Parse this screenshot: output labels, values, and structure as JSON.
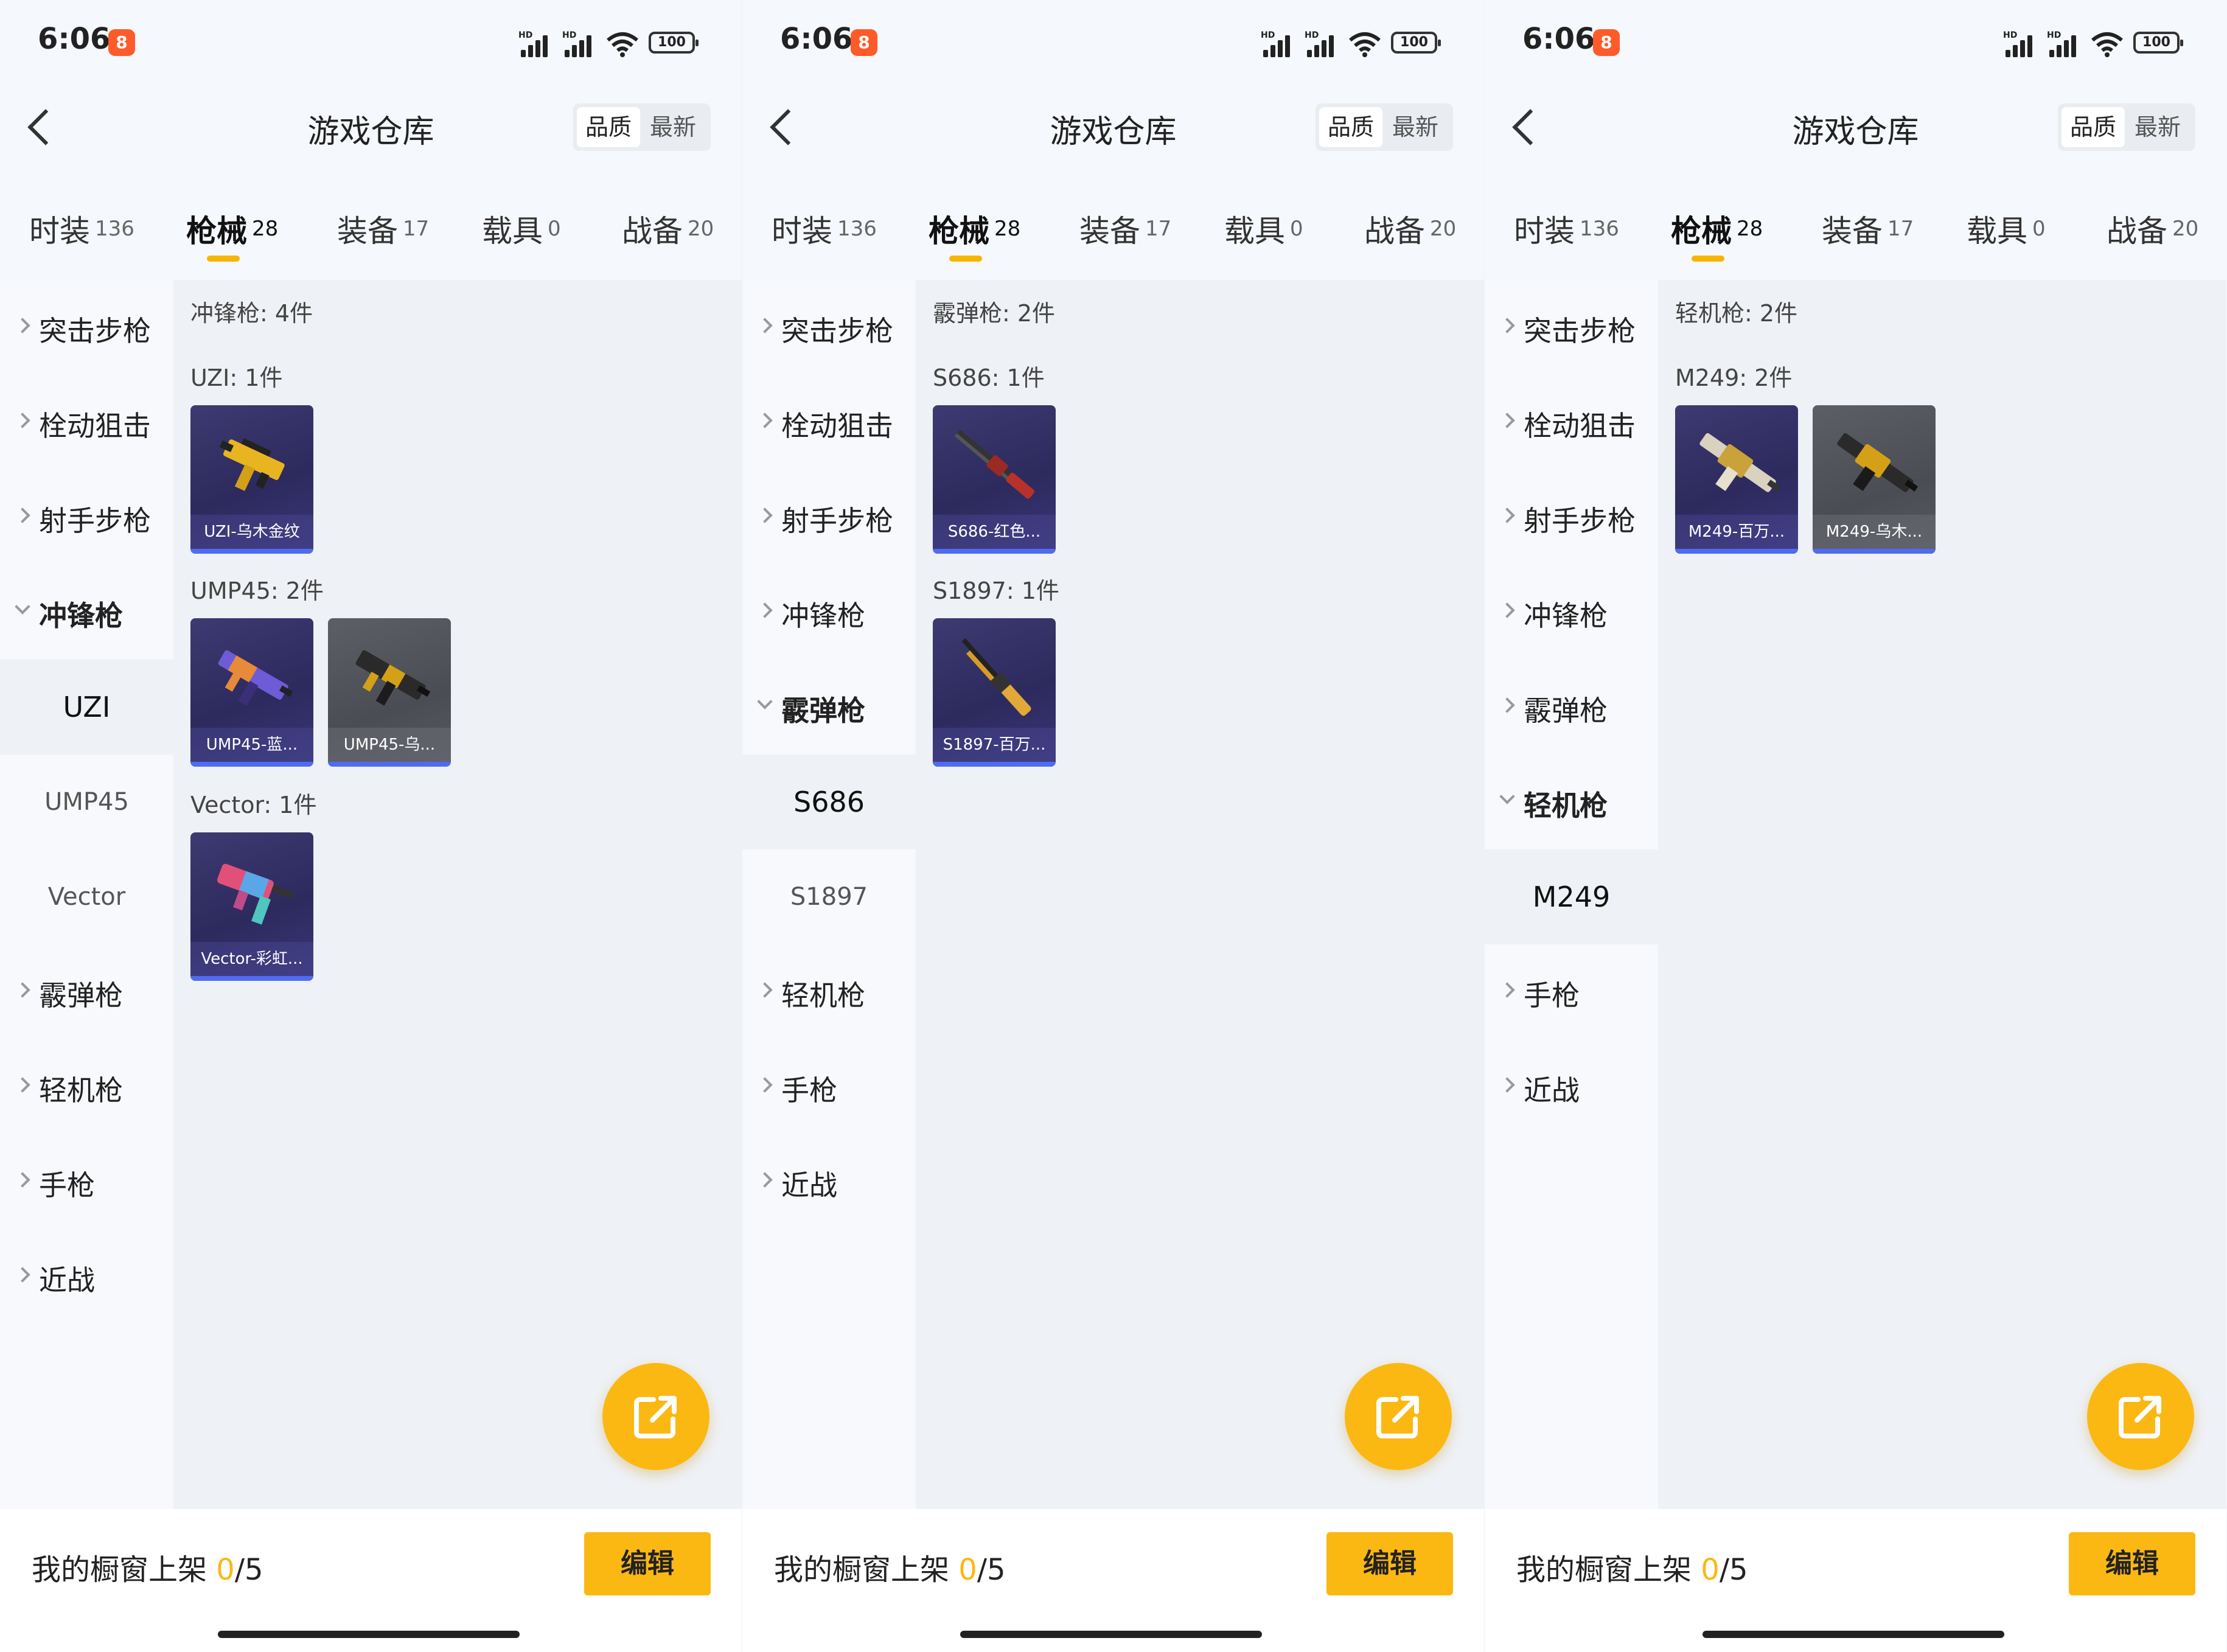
{
  "status": {
    "time": "6:06",
    "app_badge": "8",
    "hd": "HD",
    "battery": "100"
  },
  "nav": {
    "title": "游戏仓库",
    "sort_active": "品质",
    "sort_other": "最新"
  },
  "tabs": [
    {
      "label": "时装",
      "count": "136"
    },
    {
      "label": "枪械",
      "count": "28"
    },
    {
      "label": "装备",
      "count": "17"
    },
    {
      "label": "载具",
      "count": "0"
    },
    {
      "label": "战备",
      "count": "20"
    }
  ],
  "categories": {
    "assault": "突击步枪",
    "bolt": "栓动狙击",
    "marksman": "射手步枪",
    "smg": "冲锋枪",
    "shotgun": "霰弹枪",
    "lmg": "轻机枪",
    "pistol": "手枪",
    "melee": "近战"
  },
  "panels": [
    {
      "subitems": [
        "UZI",
        "UMP45",
        "Vector"
      ],
      "selected": "UZI",
      "section_title": "冲锋枪: 4件",
      "groups": [
        {
          "title": "UZI: 1件",
          "items": [
            {
              "name": "UZI-乌木金纹",
              "icon": "uzi-gold-icon",
              "style": "purple"
            }
          ]
        },
        {
          "title": "UMP45: 2件",
          "items": [
            {
              "name": "UMP45-蓝...",
              "icon": "ump45-blue-icon",
              "style": "purple"
            },
            {
              "name": "UMP45-乌...",
              "icon": "ump45-ebony-icon",
              "style": "grey"
            }
          ]
        },
        {
          "title": "Vector: 1件",
          "items": [
            {
              "name": "Vector-彩虹...",
              "icon": "vector-rainbow-icon",
              "style": "purple"
            }
          ]
        }
      ]
    },
    {
      "subitems": [
        "S686",
        "S1897"
      ],
      "selected": "S686",
      "section_title": "霰弹枪: 2件",
      "groups": [
        {
          "title": "S686: 1件",
          "items": [
            {
              "name": "S686-红色...",
              "icon": "s686-red-icon",
              "style": "purple"
            }
          ]
        },
        {
          "title": "S1897: 1件",
          "items": [
            {
              "name": "S1897-百万...",
              "icon": "s1897-million-icon",
              "style": "purple"
            }
          ]
        }
      ]
    },
    {
      "subitems": [
        "M249"
      ],
      "selected": "M249",
      "section_title": "轻机枪: 2件",
      "groups": [
        {
          "title": "M249: 2件",
          "items": [
            {
              "name": "M249-百万...",
              "icon": "m249-million-icon",
              "style": "purple"
            },
            {
              "name": "M249-乌木...",
              "icon": "m249-ebony-icon",
              "style": "grey"
            }
          ]
        }
      ]
    }
  ],
  "footer": {
    "shelf_label": "我的橱窗上架",
    "shelf_count": "0",
    "shelf_total": "/5",
    "edit_label": "编辑"
  },
  "colors": {
    "accent": "#fbb813",
    "rarity_purple": "#4f6cf0",
    "tab_indicator": "#f7b500"
  }
}
